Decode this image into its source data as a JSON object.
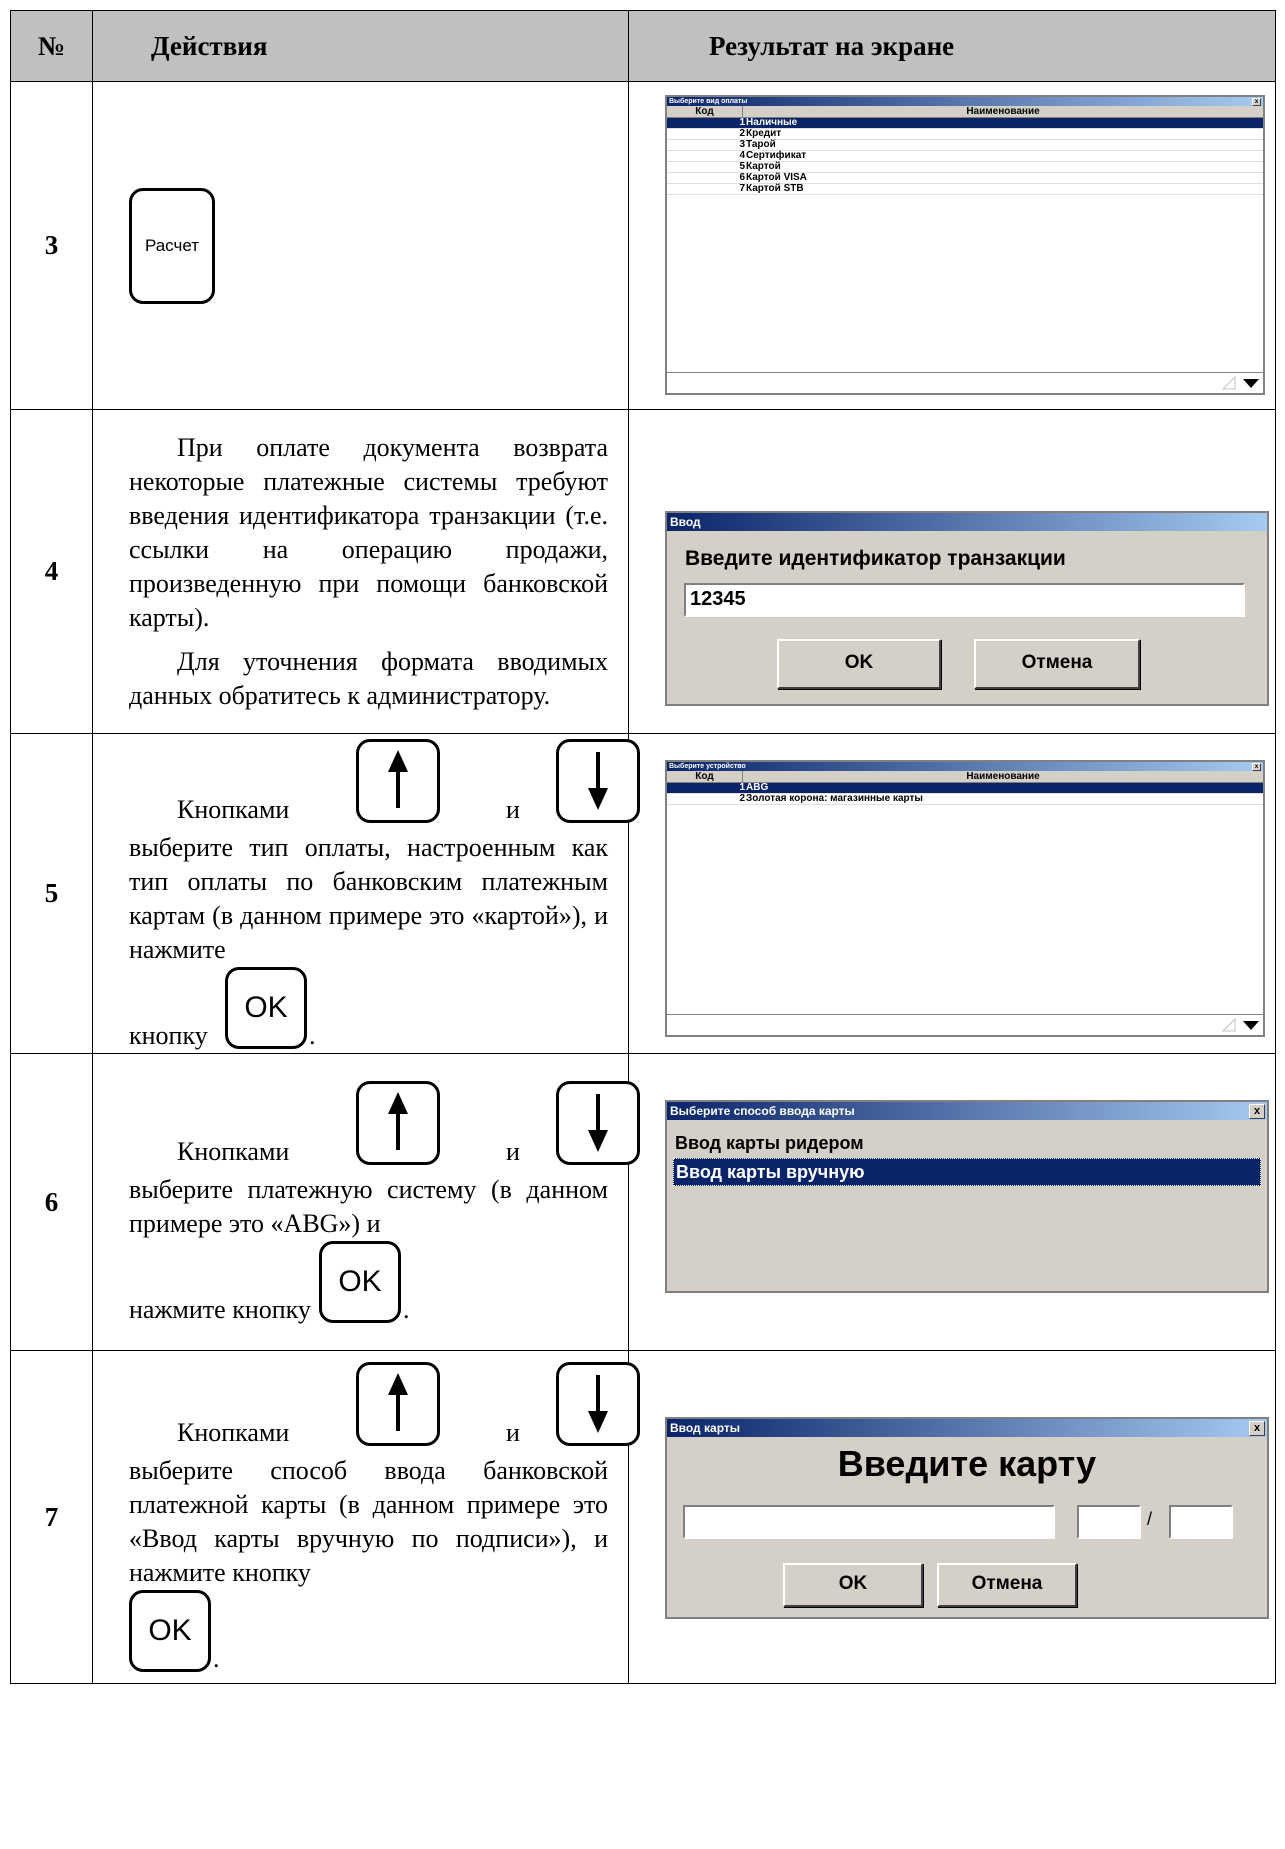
{
  "header": {
    "num": "№",
    "actions": "Действия",
    "result": "Результат на экране"
  },
  "rows": [
    {
      "num": "3",
      "key_label": "Расчет",
      "screen": {
        "title": "Выберите вид оплаты",
        "close": "x",
        "col_code": "Код",
        "col_name": "Наименование",
        "items": [
          {
            "code": "1",
            "name": "Наличные"
          },
          {
            "code": "2",
            "name": "Кредит"
          },
          {
            "code": "3",
            "name": "Тарой"
          },
          {
            "code": "4",
            "name": "Сертификат"
          },
          {
            "code": "5",
            "name": "Картой"
          },
          {
            "code": "6",
            "name": "Картой VISA"
          },
          {
            "code": "7",
            "name": "Картой STB"
          }
        ]
      }
    },
    {
      "num": "4",
      "para1": "При оплате документа возврата некоторые платежные системы требуют введения идентификатора транзакции (т.е. ссылки на операцию продажи, произведенную при помощи банковской карты).",
      "para2": "Для уточнения формата вводимых данных обратитесь к администратору.",
      "screen": {
        "title": "Ввод",
        "prompt": "Введите идентификатор транзакции",
        "value": "12345",
        "ok": "OK",
        "cancel": "Отмена"
      }
    },
    {
      "num": "5",
      "text_a": "Кнопками",
      "text_and": "и",
      "text_b": "выберите тип оплаты, настроенным как тип оплаты по банковским платежным картам (в данном примере это «картой»), и нажмите",
      "text_c": "кнопку",
      "ok_key": "OK",
      "screen": {
        "title": "Выберите устройство",
        "close": "x",
        "col_code": "Код",
        "col_name": "Наименование",
        "items": [
          {
            "code": "1",
            "name": "ABG"
          },
          {
            "code": "2",
            "name": "Золотая корона: магазинные карты"
          }
        ]
      }
    },
    {
      "num": "6",
      "text_a": "Кнопками",
      "text_and": "и",
      "text_b": "выберите платежную систему (в данном примере это «ABG») и",
      "text_c": "нажмите кнопку",
      "ok_key": "OK",
      "screen": {
        "title": "Выберите способ ввода карты",
        "close": "x",
        "items": [
          {
            "name": "Ввод карты ридером",
            "selected": false
          },
          {
            "name": "Ввод карты вручную",
            "selected": true
          }
        ]
      }
    },
    {
      "num": "7",
      "text_a": "Кнопками",
      "text_and": "и",
      "text_b": "выберите способ ввода банковской платежной карты (в данном примере это «Ввод карты вручную по подписи»), и нажмите кнопку",
      "ok_key": "OK",
      "screen": {
        "title": "Ввод карты",
        "close": "x",
        "heading": "Введите карту",
        "separator": "/",
        "ok": "OK",
        "cancel": "Отмена"
      }
    }
  ]
}
